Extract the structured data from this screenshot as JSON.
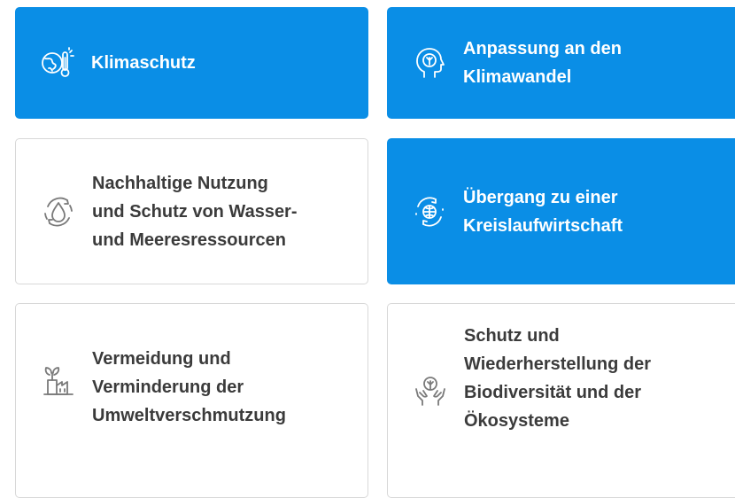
{
  "cards": [
    {
      "label": "Klimaschutz",
      "icon": "thermometer-globe-icon",
      "style": "blue"
    },
    {
      "label": "Anpassung an den\nKlimawandel",
      "icon": "head-leaf-icon",
      "style": "blue"
    },
    {
      "label": "Nachhaltige Nutzung\nund Schutz von Wasser-\nund Meeresressourcen",
      "icon": "water-drop-cycle-icon",
      "style": "white"
    },
    {
      "label": "Übergang zu einer\nKreislaufwirtschaft",
      "icon": "globe-cycle-icon",
      "style": "blue"
    },
    {
      "label": "Vermeidung und\nVerminderung der\nUmweltverschmutzung",
      "icon": "factory-plant-icon",
      "style": "white"
    },
    {
      "label": "Schutz und\nWiederherstellung der\nBiodiversität und der\nÖkosysteme",
      "icon": "hands-leaf-icon",
      "style": "white"
    }
  ],
  "colors": {
    "accent": "#0a8ee6",
    "card_text_dark": "#3b3b3b",
    "icon_gray": "#7a7a7a",
    "border": "#d8d8d8"
  }
}
